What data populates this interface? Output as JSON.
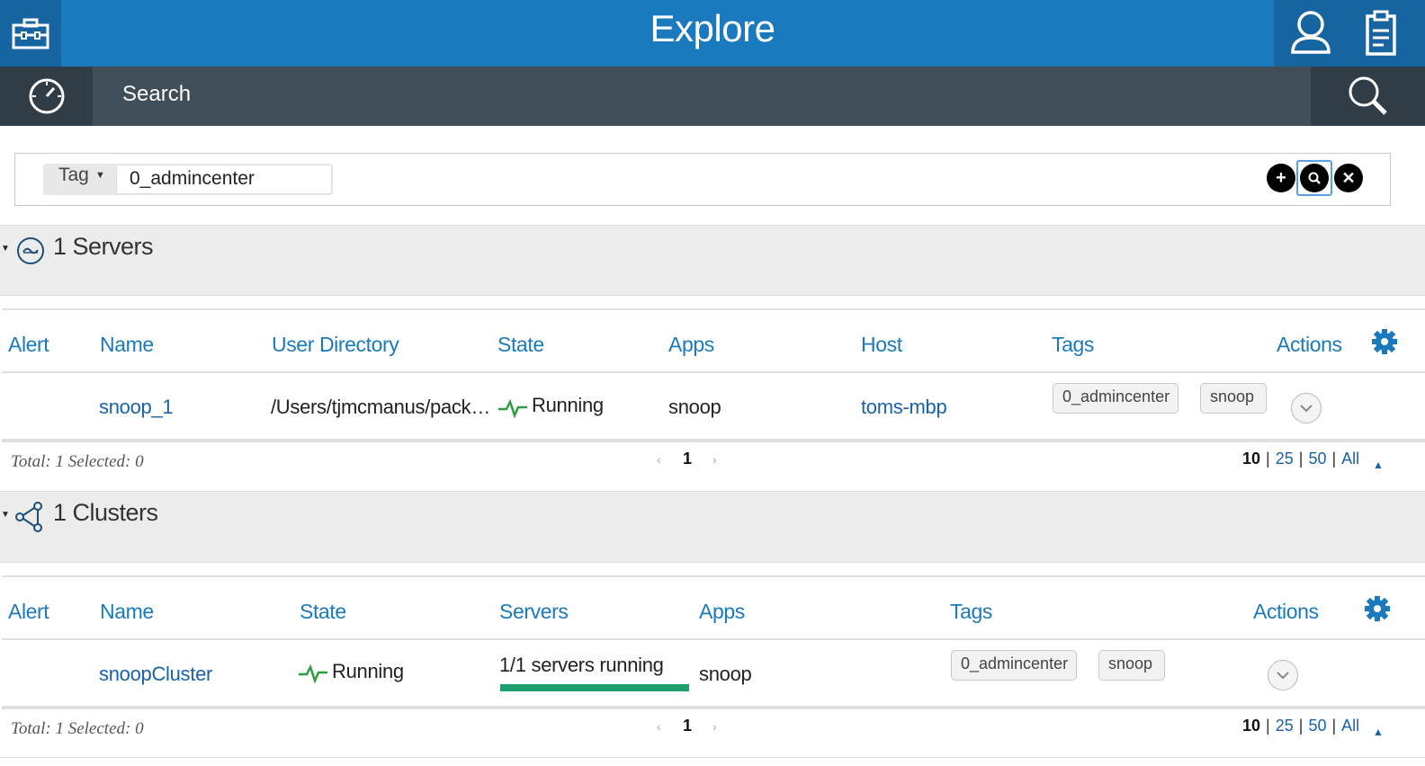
{
  "header": {
    "title": "Explore"
  },
  "subheader": {
    "label": "Search"
  },
  "search": {
    "filter_type": "Tag",
    "filter_value": "0_admincenter"
  },
  "servers_section": {
    "heading": "1 Servers",
    "columns": [
      "Alert",
      "Name",
      "User Directory",
      "State",
      "Apps",
      "Host",
      "Tags",
      "Actions"
    ],
    "rows": [
      {
        "name": "snoop_1",
        "user_directory": "/Users/tjmcmanus/pack…",
        "state": "Running",
        "apps": "snoop",
        "host": "toms-mbp",
        "tags": [
          "0_admincenter",
          "snoop"
        ]
      }
    ],
    "footer": {
      "total_text": "Total: 1 Selected: 0",
      "page": "1",
      "page_sizes": [
        "10",
        "25",
        "50",
        "All"
      ]
    }
  },
  "clusters_section": {
    "heading": "1 Clusters",
    "columns": [
      "Alert",
      "Name",
      "State",
      "Servers",
      "Apps",
      "Tags",
      "Actions"
    ],
    "rows": [
      {
        "name": "snoopCluster",
        "state": "Running",
        "servers": "1/1 servers running",
        "servers_running_fraction": 1.0,
        "apps": "snoop",
        "tags": [
          "0_admincenter",
          "snoop"
        ]
      }
    ],
    "footer": {
      "total_text": "Total: 1 Selected: 0",
      "page": "1",
      "page_sizes": [
        "10",
        "25",
        "50",
        "All"
      ]
    }
  },
  "colors": {
    "header_blue": "#1a7abd",
    "subbar_dark": "#404e59",
    "running_green": "#1e9e6c",
    "link_blue": "#1a62a8"
  }
}
